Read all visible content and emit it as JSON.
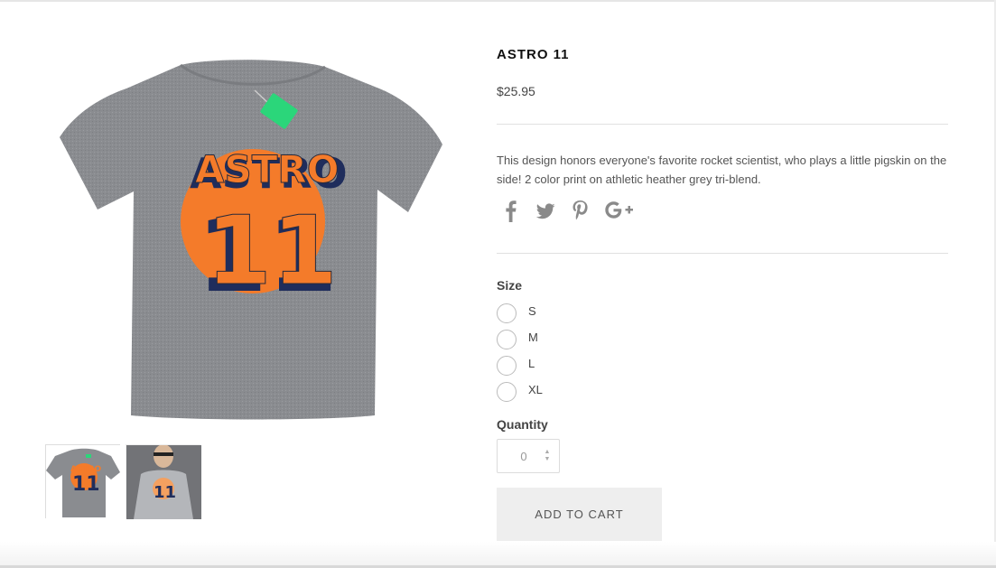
{
  "product": {
    "title": "ASTRO 11",
    "price": "$25.95",
    "description": "This design honors everyone's favorite rocket scientist, who plays a little pigskin on the side! 2 color print on athletic heather grey tri-blend.",
    "images": {
      "main": {
        "name": "main-product-image",
        "alt": "Grey Astro 11 t-shirt"
      },
      "thumbnails": [
        {
          "name": "thumbnail-shirt",
          "alt": "Astro 11 shirt thumbnail"
        },
        {
          "name": "thumbnail-model",
          "alt": "Model wearing Astro 11 shirt"
        }
      ],
      "graphic": {
        "word": "ASTRO",
        "number": "11"
      }
    }
  },
  "share": {
    "icons": [
      "facebook-icon",
      "twitter-icon",
      "pinterest-icon",
      "google-plus-icon"
    ]
  },
  "size": {
    "label": "Size",
    "options": [
      "S",
      "M",
      "L",
      "XL"
    ]
  },
  "quantity": {
    "label": "Quantity",
    "value": "0"
  },
  "cart": {
    "button_label": "ADD TO CART"
  },
  "colors": {
    "shirt_grey": "#8a8c90",
    "print_orange": "#f47b2a",
    "print_navy": "#1f2d5c",
    "tag_green": "#2bd67a"
  }
}
